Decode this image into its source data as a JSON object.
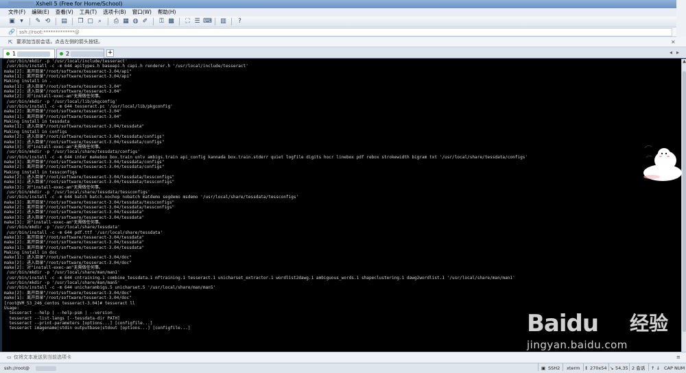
{
  "window": {
    "title": "Xshell 5 (Free for Home/School)"
  },
  "menu": [
    "文件(F)",
    "编辑(E)",
    "查看(V)",
    "工具(T)",
    "选项卡(B)",
    "窗口(W)",
    "帮助(H)"
  ],
  "toolbar": {
    "icons": [
      "new-session-icon",
      "open-folder-icon",
      "disconnect-icon",
      "reconnect-icon",
      "properties-icon",
      "copy-icon",
      "paste-icon",
      "find-icon",
      "print-icon",
      "transfer-icon",
      "globe-icon",
      "script-icon",
      "key-icon",
      "lock-icon",
      "fullscreen-icon",
      "session-list-icon",
      "compose-icon",
      "layout-icon",
      "help-icon"
    ]
  },
  "address": {
    "value": "ssh://root:*************@",
    "icon": "link-icon"
  },
  "hint": {
    "text": "要添加当前会话，点击左侧的箭头按钮。"
  },
  "tabs": [
    {
      "label": "1",
      "active": true
    },
    {
      "label": "2",
      "active": false
    }
  ],
  "terminal": {
    "lines": [
      " /usr/bin/mkdir -p '/usr/local/include/tesseract'",
      " /usr/bin/install -c -m 644 apitypes.h baseapi.h capi.h renderer.h '/usr/local/include/tesseract'",
      "make[2]: 离开目录\"/root/software/tesseract-3.04/api\"",
      "make[1]: 离开目录\"/root/software/tesseract-3.04/api\"",
      "Making install in .",
      "make[1]: 进入目录\"/root/software/tesseract-3.04\"",
      "make[2]: 进入目录\"/root/software/tesseract-3.04\"",
      "make[2]: 对\"install-exec-am\"无需做任何事。",
      " /usr/bin/mkdir -p '/usr/local/lib/pkgconfig'",
      " /usr/bin/install -c -m 644 tesseract.pc '/usr/local/lib/pkgconfig'",
      "make[2]: 离开目录\"/root/software/tesseract-3.04\"",
      "make[1]: 离开目录\"/root/software/tesseract-3.04\"",
      "Making install in tessdata",
      "make[1]: 进入目录\"/root/software/tesseract-3.04/tessdata\"",
      "Making install in configs",
      "make[2]: 进入目录\"/root/software/tesseract-3.04/tessdata/configs\"",
      "make[3]: 进入目录\"/root/software/tesseract-3.04/tessdata/configs\"",
      "make[3]: 对\"install-exec-am\"无需做任何事。",
      " /usr/bin/mkdir -p '/usr/local/share/tessdata/configs'",
      " /usr/bin/install -c -m 644 inter makebox box.train unlv ambigs.train api_config kannada box.train.stderr quiet logfile digits hocr linebox pdf rebox strokewidth bigram txt '/usr/local/share/tessdata/configs'",
      "make[3]: 离开目录\"/root/software/tesseract-3.04/tessdata/configs\"",
      "make[2]: 离开目录\"/root/software/tesseract-3.04/tessdata/configs\"",
      "Making install in tessconfigs",
      "make[2]: 进入目录\"/root/software/tesseract-3.04/tessdata/tessconfigs\"",
      "make[3]: 进入目录\"/root/software/tesseract-3.04/tessdata/tessconfigs\"",
      "make[3]: 对\"install-exec-am\"无需做任何事。",
      " /usr/bin/mkdir -p '/usr/local/share/tessdata/tessconfigs'",
      " /usr/bin/install -c -m 644 batch batch.nochop nobatch matdemo segdemo msdemo '/usr/local/share/tessdata/tessconfigs'",
      "make[3]: 离开目录\"/root/software/tesseract-3.04/tessdata/tessconfigs\"",
      "make[2]: 离开目录\"/root/software/tesseract-3.04/tessdata/tessconfigs\"",
      "make[2]: 进入目录\"/root/software/tesseract-3.04/tessdata\"",
      "make[3]: 进入目录\"/root/software/tesseract-3.04/tessdata\"",
      "make[3]: 对\"install-exec-am\"无需做任何事。",
      " /usr/bin/mkdir -p '/usr/local/share/tessdata'",
      " /usr/bin/install -c -m 644 pdf.ttf '/usr/local/share/tessdata'",
      "make[3]: 离开目录\"/root/software/tesseract-3.04/tessdata\"",
      "make[2]: 离开目录\"/root/software/tesseract-3.04/tessdata\"",
      "make[1]: 离开目录\"/root/software/tesseract-3.04/tessdata\"",
      "Making install in doc",
      "make[1]: 进入目录\"/root/software/tesseract-3.04/doc\"",
      "make[2]: 进入目录\"/root/software/tesseract-3.04/doc\"",
      "make[2]: 对\"install-exec-am\"无需做任何事。",
      " /usr/bin/mkdir -p '/usr/local/share/man/man1'",
      " /usr/bin/install -c -m 644 cntraining.1 combine_tessdata.1 mftraining.1 tesseract.1 unicharset_extractor.1 wordlist2dawg.1 ambiguous_words.1 shapeclustering.1 dawg2wordlist.1 '/usr/local/share/man/man1'",
      " /usr/bin/mkdir -p '/usr/local/share/man/man5'",
      " /usr/bin/install -c -m 644 unicharambigs.5 unicharset.5 '/usr/local/share/man/man5'",
      "make[2]: 离开目录\"/root/software/tesseract-3.04/doc\"",
      "make[1]: 离开目录\"/root/software/tesseract-3.04/doc\"",
      "[root@VM_53_246_centos tesseract-3.04]# tesseract ll",
      "Usage:",
      "  tesseract --help | --help-psm | --version",
      "  tesseract --list-langs [--tessdata-dir PATH]",
      "  tesseract --print-parameters [options...] [configfile...]",
      "  tesseract imagename|stdin outputbase|stdout [options...] [configfile...]"
    ]
  },
  "compose": {
    "placeholder": "仅将文本发送到当前选项卡"
  },
  "status": {
    "connection": "ssh://root@",
    "protocol": "SSH2",
    "terminal": "xterm",
    "size": "270x54",
    "cursor": "54,35",
    "sessions": "2 会话",
    "caps": "CAP",
    "num": "NUM"
  },
  "watermark": {
    "logo": "Baidu",
    "label": "经验",
    "url": "jingyan.baidu.com"
  },
  "colors": {
    "terminal_bg": "#000000",
    "terminal_fg": "#d8d8d8",
    "titlebar": "#8fb3d9"
  }
}
